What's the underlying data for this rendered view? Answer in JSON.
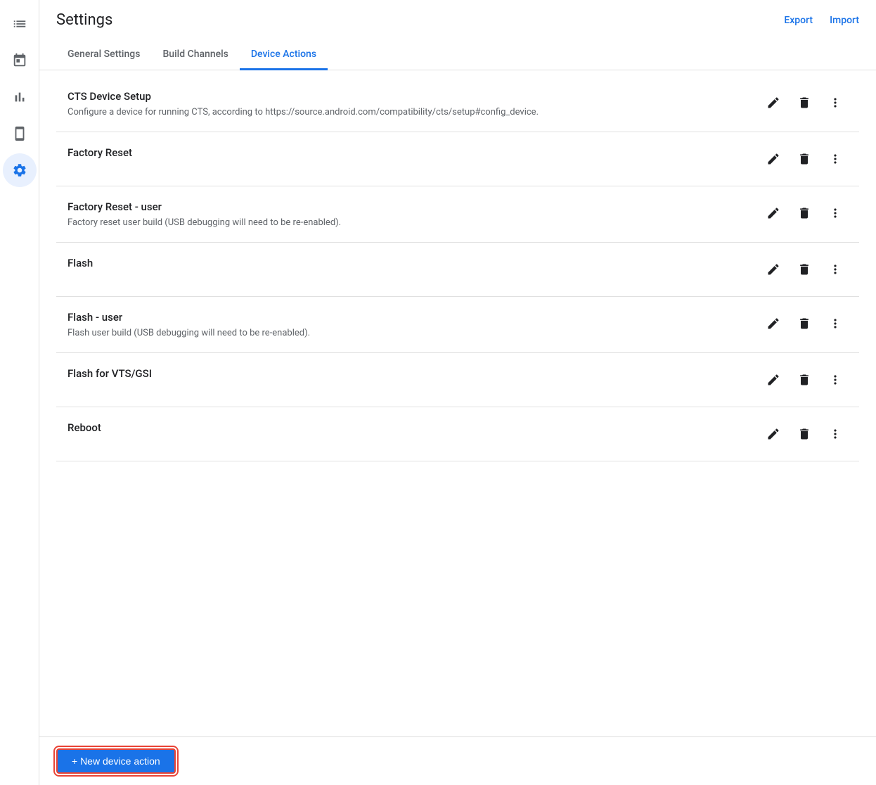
{
  "header": {
    "title": "Settings",
    "export_label": "Export",
    "import_label": "Import"
  },
  "tabs": [
    {
      "id": "general",
      "label": "General Settings",
      "active": false
    },
    {
      "id": "build-channels",
      "label": "Build Channels",
      "active": false
    },
    {
      "id": "device-actions",
      "label": "Device Actions",
      "active": true
    }
  ],
  "sidebar": {
    "items": [
      {
        "id": "reports",
        "icon": "list-icon",
        "active": false
      },
      {
        "id": "calendar",
        "icon": "calendar-icon",
        "active": false
      },
      {
        "id": "analytics",
        "icon": "bar-chart-icon",
        "active": false
      },
      {
        "id": "device",
        "icon": "device-icon",
        "active": false
      },
      {
        "id": "settings",
        "icon": "settings-icon",
        "active": true
      }
    ]
  },
  "actions": [
    {
      "id": "cts-device-setup",
      "name": "CTS Device Setup",
      "description": "Configure a device for running CTS, according to https://source.android.com/compatibility/cts/setup#config_device."
    },
    {
      "id": "factory-reset",
      "name": "Factory Reset",
      "description": ""
    },
    {
      "id": "factory-reset-user",
      "name": "Factory Reset - user",
      "description": "Factory reset user build (USB debugging will need to be re-enabled)."
    },
    {
      "id": "flash",
      "name": "Flash",
      "description": ""
    },
    {
      "id": "flash-user",
      "name": "Flash - user",
      "description": "Flash user build (USB debugging will need to be re-enabled)."
    },
    {
      "id": "flash-vts-gsi",
      "name": "Flash for VTS/GSI",
      "description": ""
    },
    {
      "id": "reboot",
      "name": "Reboot",
      "description": ""
    }
  ],
  "bottom_bar": {
    "new_action_label": "+ New device action"
  }
}
